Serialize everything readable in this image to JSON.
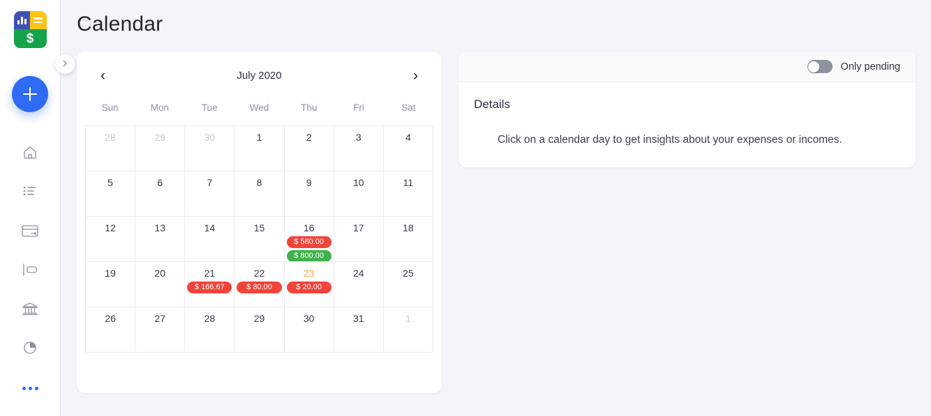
{
  "app": {
    "logo": {
      "name": "app-logo",
      "currency_symbol": "$"
    },
    "page_title": "Calendar",
    "background_color": "#f4f5f9",
    "accent_color": "#2f6bf5"
  },
  "sidebar": {
    "add_button": {
      "label": "+",
      "icon": "plus-icon"
    },
    "collapse_button": {
      "icon": "chevron-right-icon"
    },
    "items": [
      {
        "name": "sidebar-item-home",
        "icon": "home-icon"
      },
      {
        "name": "sidebar-item-transactions",
        "icon": "list-icon"
      },
      {
        "name": "sidebar-item-cards",
        "icon": "credit-card-icon"
      },
      {
        "name": "sidebar-item-tags",
        "icon": "tag-icon"
      },
      {
        "name": "sidebar-item-accounts",
        "icon": "bank-icon"
      },
      {
        "name": "sidebar-item-reports",
        "icon": "pie-chart-icon"
      },
      {
        "name": "sidebar-item-more",
        "icon": "more-dots-icon"
      }
    ]
  },
  "calendar": {
    "prev_label": "‹",
    "next_label": "›",
    "month": "July 2020",
    "weekdays": [
      "Sun",
      "Mon",
      "Tue",
      "Wed",
      "Thu",
      "Fri",
      "Sat"
    ],
    "colors": {
      "expense": "#f2443a",
      "income": "#3fb24b",
      "today": "#f0ad2e"
    },
    "days": [
      {
        "num": "28",
        "muted": true,
        "today": false,
        "events": []
      },
      {
        "num": "29",
        "muted": true,
        "today": false,
        "events": []
      },
      {
        "num": "30",
        "muted": true,
        "today": false,
        "events": []
      },
      {
        "num": "1",
        "muted": false,
        "today": false,
        "events": []
      },
      {
        "num": "2",
        "muted": false,
        "today": false,
        "events": []
      },
      {
        "num": "3",
        "muted": false,
        "today": false,
        "events": []
      },
      {
        "num": "4",
        "muted": false,
        "today": false,
        "events": []
      },
      {
        "num": "5",
        "muted": false,
        "today": false,
        "events": []
      },
      {
        "num": "6",
        "muted": false,
        "today": false,
        "events": []
      },
      {
        "num": "7",
        "muted": false,
        "today": false,
        "events": []
      },
      {
        "num": "8",
        "muted": false,
        "today": false,
        "events": []
      },
      {
        "num": "9",
        "muted": false,
        "today": false,
        "events": []
      },
      {
        "num": "10",
        "muted": false,
        "today": false,
        "events": []
      },
      {
        "num": "11",
        "muted": false,
        "today": false,
        "events": []
      },
      {
        "num": "12",
        "muted": false,
        "today": false,
        "events": []
      },
      {
        "num": "13",
        "muted": false,
        "today": false,
        "events": []
      },
      {
        "num": "14",
        "muted": false,
        "today": false,
        "events": []
      },
      {
        "num": "15",
        "muted": false,
        "today": false,
        "events": []
      },
      {
        "num": "16",
        "muted": false,
        "today": false,
        "events": [
          {
            "label": "$ 580.00",
            "type": "expense"
          },
          {
            "label": "$ 800.00",
            "type": "income"
          }
        ]
      },
      {
        "num": "17",
        "muted": false,
        "today": false,
        "events": []
      },
      {
        "num": "18",
        "muted": false,
        "today": false,
        "events": []
      },
      {
        "num": "19",
        "muted": false,
        "today": false,
        "events": []
      },
      {
        "num": "20",
        "muted": false,
        "today": false,
        "events": []
      },
      {
        "num": "21",
        "muted": false,
        "today": false,
        "events": [
          {
            "label": "$ 166.67",
            "type": "expense"
          }
        ]
      },
      {
        "num": "22",
        "muted": false,
        "today": false,
        "events": [
          {
            "label": "$ 80.00",
            "type": "expense"
          }
        ]
      },
      {
        "num": "23",
        "muted": false,
        "today": true,
        "events": [
          {
            "label": "$ 20.00",
            "type": "expense"
          }
        ]
      },
      {
        "num": "24",
        "muted": false,
        "today": false,
        "events": []
      },
      {
        "num": "25",
        "muted": false,
        "today": false,
        "events": []
      },
      {
        "num": "26",
        "muted": false,
        "today": false,
        "events": []
      },
      {
        "num": "27",
        "muted": false,
        "today": false,
        "events": []
      },
      {
        "num": "28",
        "muted": false,
        "today": false,
        "events": []
      },
      {
        "num": "29",
        "muted": false,
        "today": false,
        "events": []
      },
      {
        "num": "30",
        "muted": false,
        "today": false,
        "events": []
      },
      {
        "num": "31",
        "muted": false,
        "today": false,
        "events": []
      },
      {
        "num": "1",
        "muted": true,
        "today": false,
        "events": []
      }
    ]
  },
  "details": {
    "toggle": {
      "label": "Only pending",
      "checked": false
    },
    "title": "Details",
    "empty_text": "Click on a calendar day to get insights about your expenses or incomes."
  }
}
